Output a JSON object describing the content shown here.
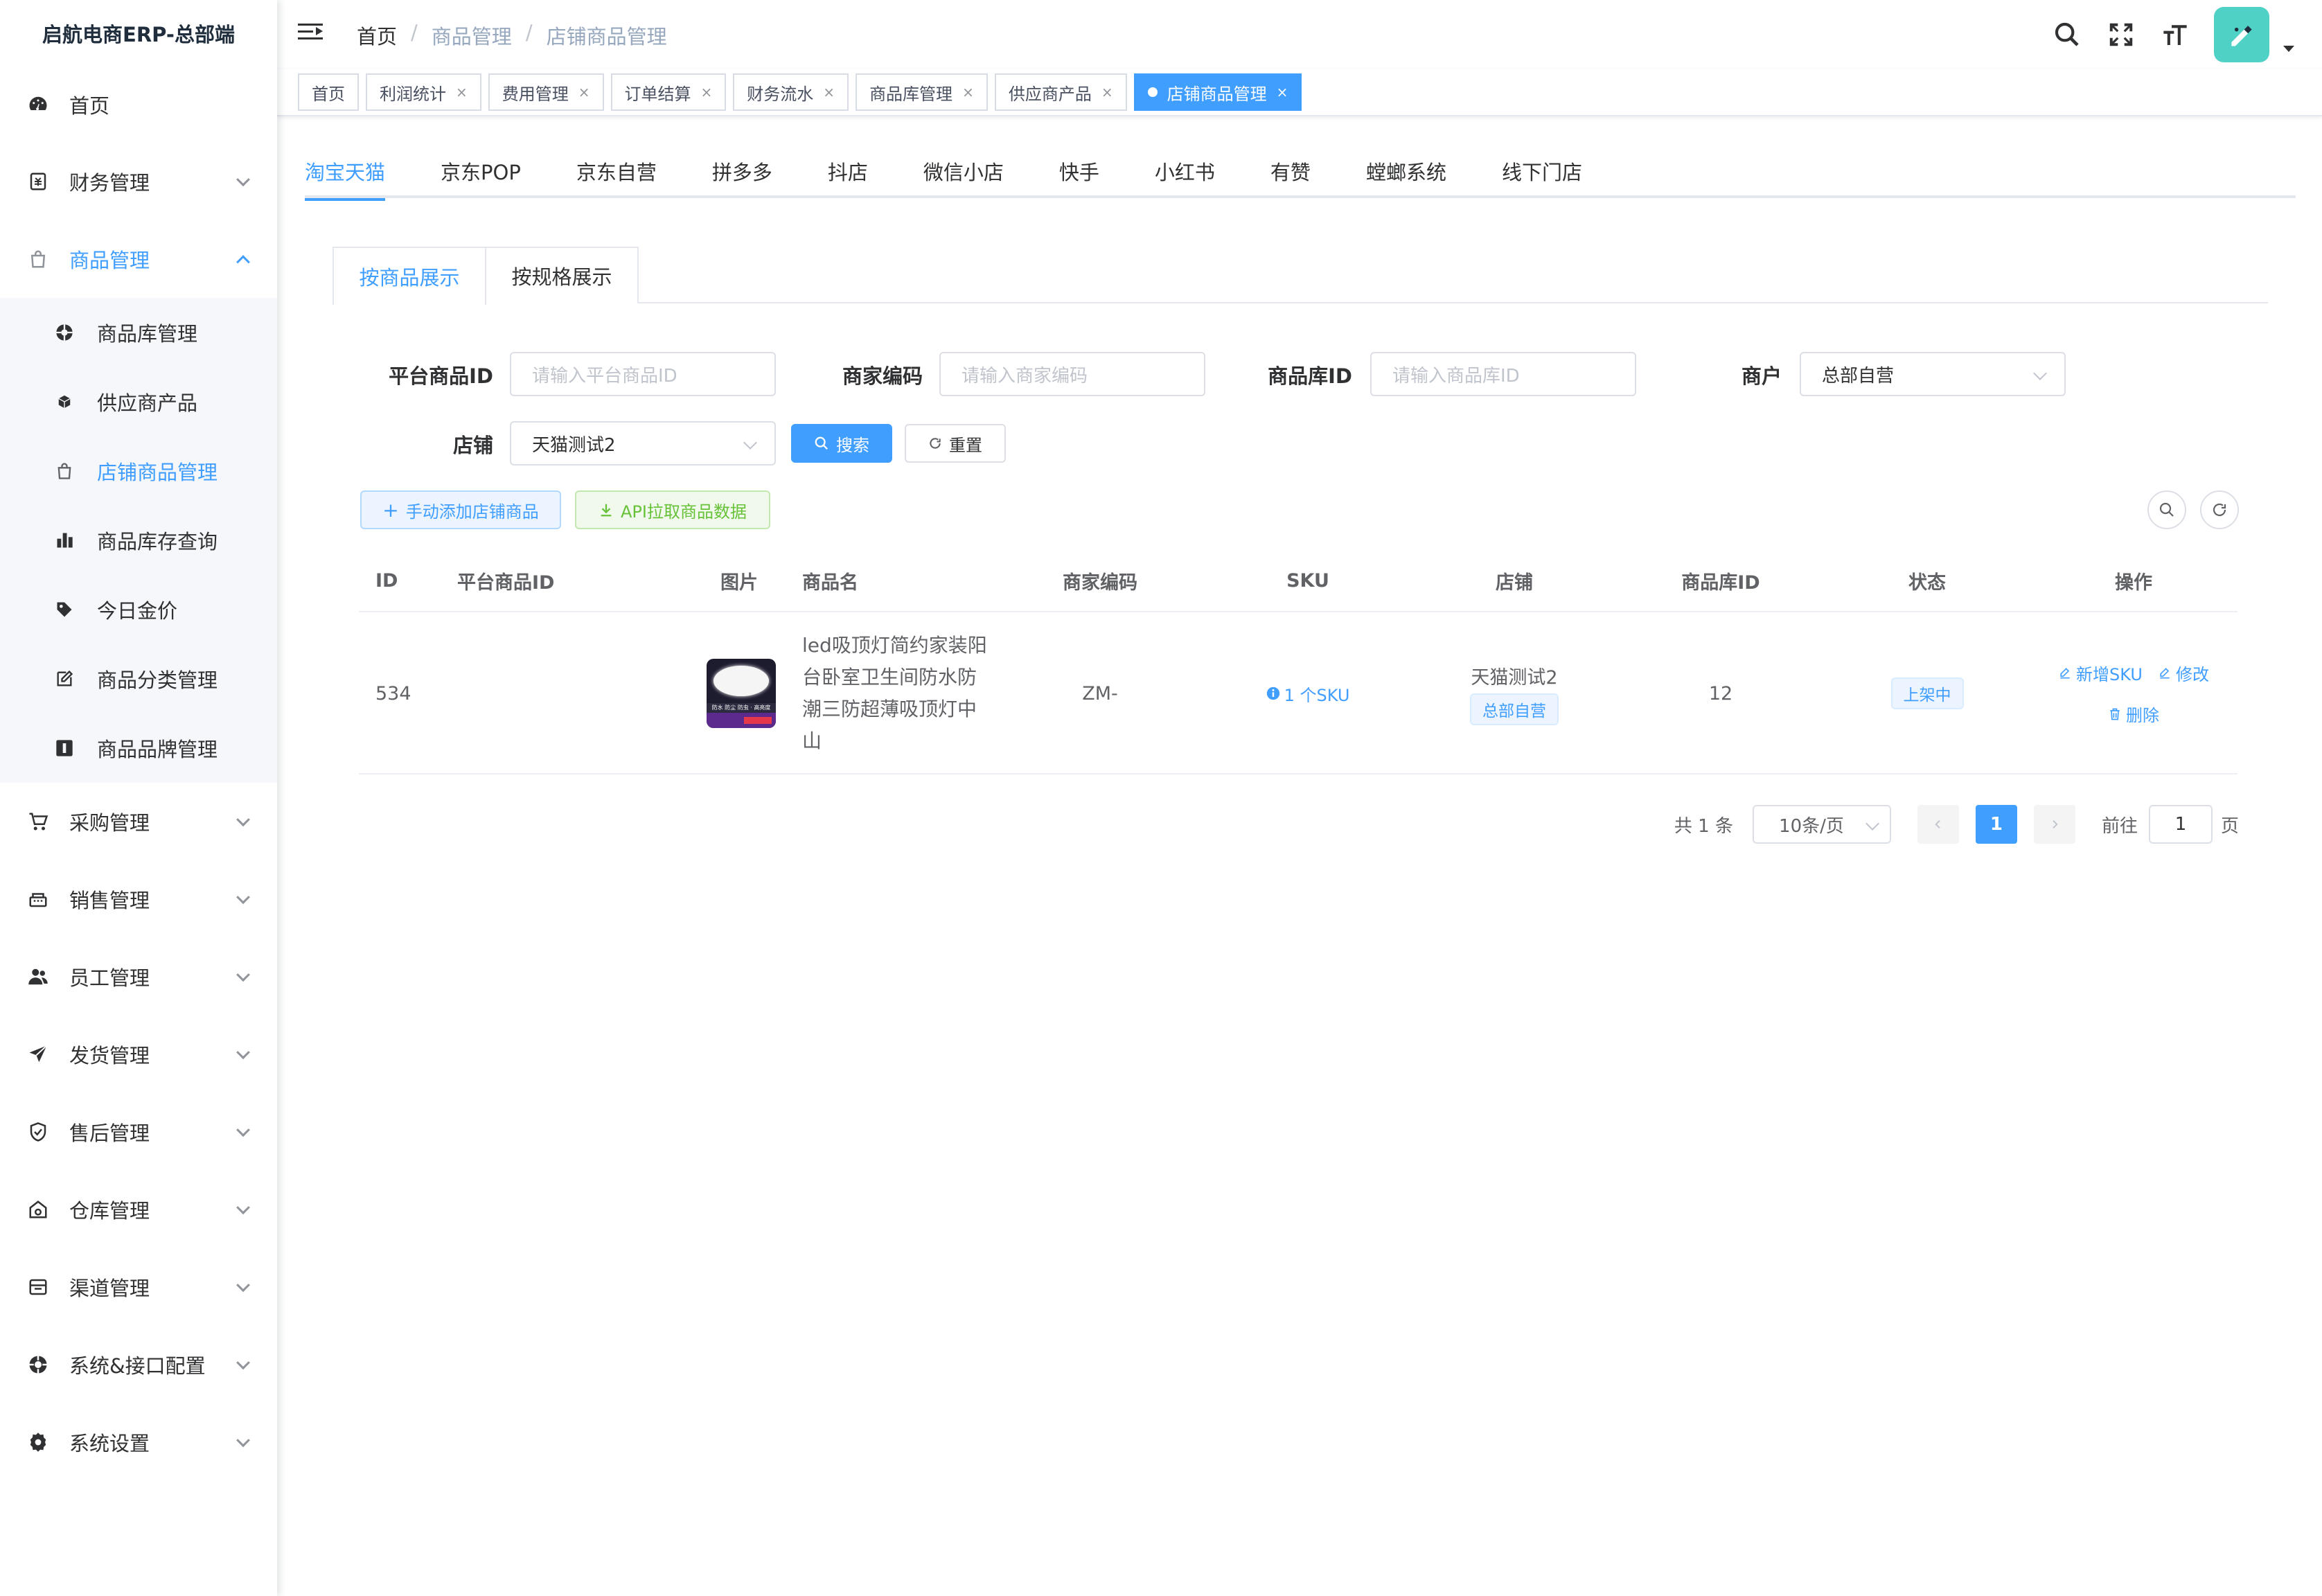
{
  "app": {
    "title": "启航电商ERP-总部端"
  },
  "sidebar": {
    "menu": [
      {
        "label": "首页",
        "icon": "dashboard-icon"
      },
      {
        "label": "财务管理",
        "icon": "finance-icon"
      },
      {
        "label": "商品管理",
        "icon": "shopping-bag-icon"
      }
    ],
    "submenu": [
      {
        "label": "商品库管理",
        "icon": "aperture-icon"
      },
      {
        "label": "供应商产品",
        "icon": "box-icon"
      },
      {
        "label": "店铺商品管理",
        "icon": "shopping-bag-icon"
      },
      {
        "label": "商品库存查询",
        "icon": "bar-chart-icon"
      },
      {
        "label": "今日金价",
        "icon": "price-tag-icon"
      },
      {
        "label": "商品分类管理",
        "icon": "edit-icon"
      },
      {
        "label": "商品品牌管理",
        "icon": "brand-icon"
      }
    ],
    "menu_after": [
      {
        "label": "采购管理",
        "icon": "cart-icon"
      },
      {
        "label": "销售管理",
        "icon": "sales-icon"
      },
      {
        "label": "员工管理",
        "icon": "people-icon"
      },
      {
        "label": "发货管理",
        "icon": "send-icon"
      },
      {
        "label": "售后管理",
        "icon": "shield-icon"
      },
      {
        "label": "仓库管理",
        "icon": "warehouse-icon"
      },
      {
        "label": "渠道管理",
        "icon": "channel-icon"
      },
      {
        "label": "系统&接口配置",
        "icon": "api-icon"
      },
      {
        "label": "系统设置",
        "icon": "gear-icon"
      }
    ]
  },
  "header": {
    "breadcrumb": [
      "首页",
      "商品管理",
      "店铺商品管理"
    ],
    "breadcrumb_sep": "/"
  },
  "tags": [
    {
      "label": "首页",
      "closable": false
    },
    {
      "label": "利润统计",
      "closable": true
    },
    {
      "label": "费用管理",
      "closable": true
    },
    {
      "label": "订单结算",
      "closable": true
    },
    {
      "label": "财务流水",
      "closable": true
    },
    {
      "label": "商品库管理",
      "closable": true
    },
    {
      "label": "供应商产品",
      "closable": true
    },
    {
      "label": "店铺商品管理",
      "closable": true,
      "active": true
    }
  ],
  "platform_tabs": [
    "淘宝天猫",
    "京东POP",
    "京东自营",
    "拼多多",
    "抖店",
    "微信小店",
    "快手",
    "小红书",
    "有赞",
    "螳螂系统",
    "线下门店"
  ],
  "view_tabs": [
    "按商品展示",
    "按规格展示"
  ],
  "search_form": {
    "platform_id_label": "平台商品ID",
    "platform_id_placeholder": "请输入平台商品ID",
    "merchant_code_label": "商家编码",
    "merchant_code_placeholder": "请输入商家编码",
    "library_id_label": "商品库ID",
    "library_id_placeholder": "请输入商品库ID",
    "merchant_label": "商户",
    "merchant_value": "总部自营",
    "shop_label": "店铺",
    "shop_value": "天猫测试2",
    "search_button": "搜索",
    "reset_button": "重置"
  },
  "toolbar": {
    "add_button": "手动添加店铺商品",
    "api_button": "API拉取商品数据"
  },
  "table": {
    "columns": [
      "ID",
      "平台商品ID",
      "图片",
      "商品名",
      "商家编码",
      "SKU",
      "店铺",
      "商品库ID",
      "状态",
      "操作"
    ],
    "rows": [
      {
        "id": "534",
        "platform_id": "",
        "name": "led吸顶灯简约家装阳台卧室卫生间防水防潮三防超薄吸顶灯中山",
        "merchant_code": "ZM-",
        "sku": "1 个SKU",
        "shop": "天猫测试2",
        "shop_tag": "总部自营",
        "library_id": "12",
        "status": "上架中",
        "actions": {
          "add_sku": "新增SKU",
          "edit": "修改",
          "delete": "删除"
        },
        "thumb_text": "防水 防尘 防虫 · 高亮度"
      }
    ]
  },
  "pagination": {
    "total": "共 1 条",
    "page_size": "10条/页",
    "current": "1",
    "goto_label": "前往",
    "goto_value": "1",
    "page_suffix": "页"
  },
  "colors": {
    "primary": "#409eff",
    "success": "#67c23a",
    "avatar": "#4fd1c5"
  }
}
